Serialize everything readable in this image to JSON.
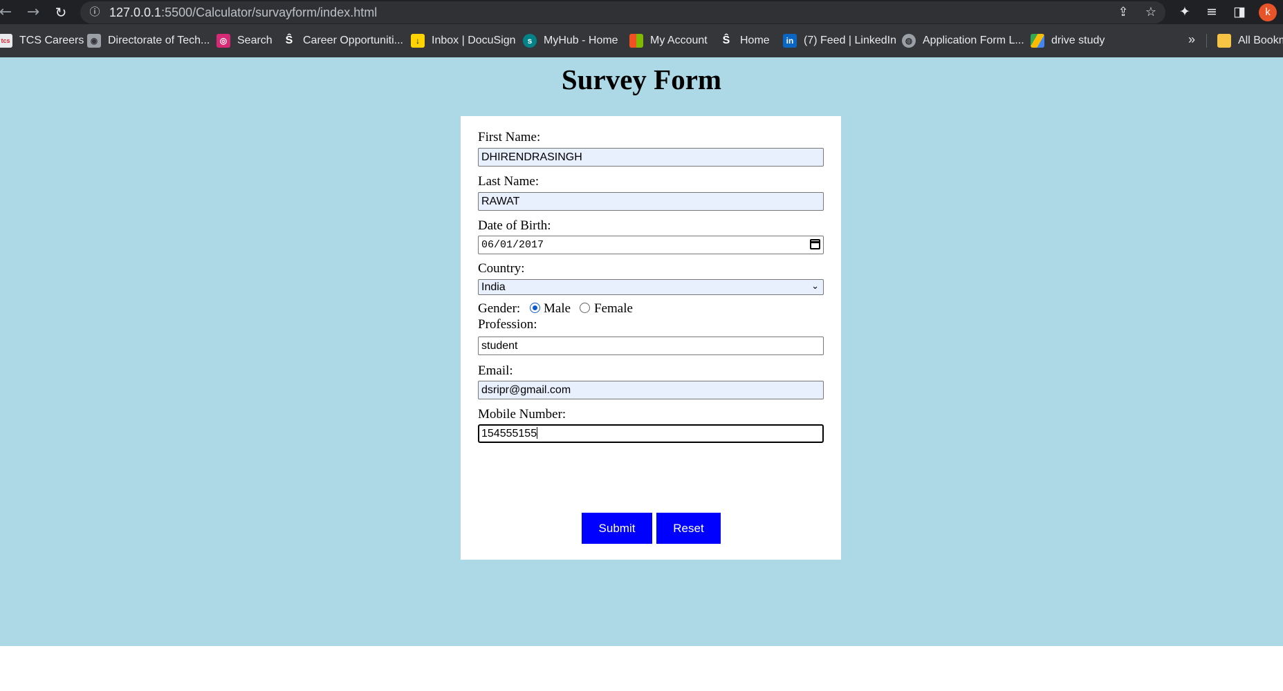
{
  "browser": {
    "url_host": "127.0.0.1",
    "url_rest": ":5500/Calculator/survayform/index.html",
    "profile_initial": "k",
    "bookmarks": [
      {
        "label": "TCS Careers",
        "icon": "tcs-icon",
        "color": "#e8eaed"
      },
      {
        "label": "Directorate of Tech...",
        "icon": "emblem-icon",
        "color": "#9aa0a6"
      },
      {
        "label": "Search",
        "icon": "instagram-icon",
        "color": "#d62976"
      },
      {
        "label": "Career Opportuniti...",
        "icon": "sf-icon",
        "color": "#ffffff"
      },
      {
        "label": "Inbox | DocuSign",
        "icon": "docusign-icon",
        "color": "#ffd400"
      },
      {
        "label": "MyHub - Home",
        "icon": "sharepoint-icon",
        "color": "#038387"
      },
      {
        "label": "My Account",
        "icon": "microsoft-icon",
        "color": "#f25022"
      },
      {
        "label": "Home",
        "icon": "sf-icon",
        "color": "#ffffff"
      },
      {
        "label": "(7) Feed | LinkedIn",
        "icon": "linkedin-icon",
        "color": "#0a66c2"
      },
      {
        "label": "Application Form L...",
        "icon": "globe-icon",
        "color": "#9aa0a6"
      },
      {
        "label": "drive study",
        "icon": "google-drive-icon",
        "color": "#34a853"
      }
    ],
    "more_label": "»",
    "all_bookmarks_label": "All Bookm"
  },
  "page": {
    "title": "Survey Form",
    "background": "#add8e6"
  },
  "form": {
    "first_name_label": "First Name:",
    "first_name_value": "DHIRENDRASINGH",
    "last_name_label": "Last Name:",
    "last_name_value": "RAWAT",
    "dob_label": "Date of Birth:",
    "dob_value": "06/01/2017",
    "country_label": "Country:",
    "country_value": "India",
    "gender_label": "Gender:",
    "gender_options": [
      "Male",
      "Female"
    ],
    "gender_selected": "Male",
    "profession_label": "Profession:",
    "profession_value": "student",
    "email_label": "Email:",
    "email_value": "dsripr@gmail.com",
    "mobile_label": "Mobile Number:",
    "mobile_value": "154555155",
    "submit_label": "Submit",
    "reset_label": "Reset",
    "button_color": "#0000ff"
  }
}
